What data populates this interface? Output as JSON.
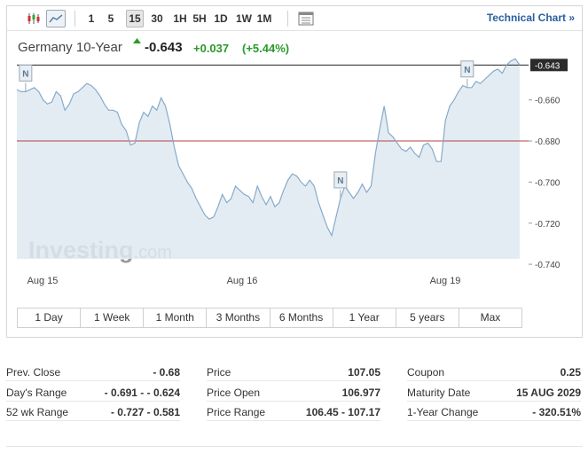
{
  "toolbar": {
    "timeframes": [
      "1",
      "5",
      "15",
      "30",
      "1H",
      "5H",
      "1D",
      "1W",
      "1M"
    ],
    "active_timeframe": "15",
    "technical_chart_label": "Technical Chart »"
  },
  "instrument": {
    "name": "Germany 10-Year",
    "last": "-0.643",
    "change_abs": "+0.037",
    "change_pct": "(+5.44%)",
    "up_color": "#2a9a2a"
  },
  "chart_data": {
    "type": "area",
    "y_ticks": [
      "-0.643",
      "-0.660",
      "-0.680",
      "-0.700",
      "-0.720",
      "-0.740"
    ],
    "ylim": [
      -0.746,
      -0.642
    ],
    "x_labels": [
      "Aug 15",
      "Aug 16",
      "Aug 19"
    ],
    "last_value": -0.643,
    "prev_close": -0.68,
    "series": [
      {
        "values": [
          -0.655,
          -0.656,
          -0.656,
          -0.655,
          -0.654,
          -0.656,
          -0.66,
          -0.662,
          -0.661,
          -0.656,
          -0.658,
          -0.665,
          -0.662,
          -0.657,
          -0.656,
          -0.654,
          -0.652,
          -0.653,
          -0.655,
          -0.658,
          -0.662,
          -0.665,
          -0.665,
          -0.666,
          -0.672,
          -0.675,
          -0.682,
          -0.681,
          -0.671,
          -0.666,
          -0.668,
          -0.663,
          -0.665,
          -0.659,
          -0.663,
          -0.672,
          -0.683,
          -0.692,
          -0.696,
          -0.7,
          -0.703,
          -0.708,
          -0.712,
          -0.716,
          -0.718,
          -0.717,
          -0.712,
          -0.706,
          -0.71,
          -0.708,
          -0.702,
          -0.704,
          -0.706,
          -0.707,
          -0.71,
          -0.702,
          -0.707,
          -0.711,
          -0.707,
          -0.712,
          -0.71,
          -0.704,
          -0.699,
          -0.696,
          -0.697,
          -0.7,
          -0.702,
          -0.699,
          -0.702,
          -0.71,
          -0.716,
          -0.722,
          -0.726,
          -0.717,
          -0.708,
          -0.702,
          -0.705,
          -0.708,
          -0.705,
          -0.701,
          -0.705,
          -0.702,
          -0.686,
          -0.674,
          -0.663,
          -0.676,
          -0.678,
          -0.681,
          -0.684,
          -0.685,
          -0.683,
          -0.686,
          -0.688,
          -0.682,
          -0.681,
          -0.684,
          -0.69,
          -0.69,
          -0.67,
          -0.663,
          -0.66,
          -0.656,
          -0.653,
          -0.654,
          -0.654,
          -0.651,
          -0.652,
          -0.65,
          -0.648,
          -0.646,
          -0.645,
          -0.647,
          -0.643,
          -0.641,
          -0.64,
          -0.643
        ]
      }
    ],
    "markers": [
      "N",
      "N",
      "N"
    ],
    "watermark": "Investing.com"
  },
  "ranges": [
    "1 Day",
    "1 Week",
    "1 Month",
    "3 Months",
    "6 Months",
    "1 Year",
    "5 years",
    "Max"
  ],
  "stats": [
    [
      {
        "label": "Prev. Close",
        "value": "- 0.68"
      },
      {
        "label": "Day's Range",
        "value": "- 0.691 - - 0.624"
      },
      {
        "label": "52 wk Range",
        "value": "- 0.727 - 0.581"
      }
    ],
    [
      {
        "label": "Price",
        "value": "107.05"
      },
      {
        "label": "Price Open",
        "value": "106.977"
      },
      {
        "label": "Price Range",
        "value": "106.45 - 107.17"
      }
    ],
    [
      {
        "label": "Coupon",
        "value": "0.25"
      },
      {
        "label": "Maturity Date",
        "value": "15 AUG 2029"
      },
      {
        "label": "1-Year Change",
        "value": "- 320.51%"
      }
    ]
  ]
}
